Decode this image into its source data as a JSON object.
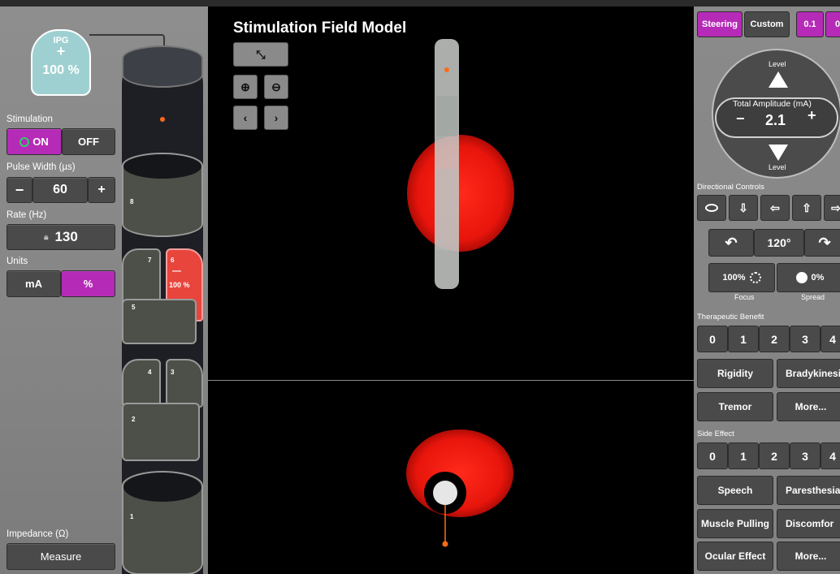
{
  "left": {
    "ipg": {
      "title": "IPG",
      "plus": "+",
      "value": "100 %"
    },
    "stimulation_label": "Stimulation",
    "on_label": "ON",
    "off_label": "OFF",
    "pulse_width_label": "Pulse Width (µs)",
    "pulse_minus": "−",
    "pulse_value": "60",
    "pulse_plus": "+",
    "rate_label": "Rate (Hz)",
    "rate_value": "130",
    "units_label": "Units",
    "unit_ma": "mA",
    "unit_pct": "%",
    "impedance_label": "Impedance (Ω)",
    "measure_label": "Measure",
    "contacts": {
      "c1": "1",
      "c2": "2",
      "c3": "3",
      "c4": "4",
      "c5": "5",
      "c6": "6",
      "c7": "7",
      "c8": "8",
      "c6_value": "100 %"
    }
  },
  "center": {
    "title": "Stimulation Field Model"
  },
  "right": {
    "tabs": {
      "steering": "Steering",
      "custom": "Custom",
      "step1": "0.1",
      "step2": "0"
    },
    "level_top": "Level",
    "level_bottom": "Level",
    "total_amp_label": "Total Amplitude (mA)",
    "amp_minus": "−",
    "amp_value": "2.1",
    "amp_plus": "+",
    "directional_label": "Directional Controls",
    "angle_value": "120°",
    "focus_value": "100%",
    "focus_label": "Focus",
    "spread_value": "0%",
    "spread_label": "Spread",
    "therapeutic_label": "Therapeutic Benefit",
    "tb_scores": [
      "0",
      "1",
      "2",
      "3",
      "4"
    ],
    "tb_rigidity": "Rigidity",
    "tb_brady": "Bradykinesi",
    "tb_tremor": "Tremor",
    "tb_more": "More...",
    "side_effect_label": "Side Effect",
    "se_scores": [
      "0",
      "1",
      "2",
      "3",
      "4"
    ],
    "se_speech": "Speech",
    "se_paresthesia": "Paresthesia",
    "se_muscle": "Muscle Pulling",
    "se_discomfort": "Discomfor",
    "se_ocular": "Ocular Effect",
    "se_more": "More..."
  },
  "colors": {
    "accent": "#b52bb7",
    "active_contact": "#e8453c",
    "field": "#ff1a1a",
    "ipg": "#9fd0d1",
    "on_indicator": "#2bd36a"
  }
}
